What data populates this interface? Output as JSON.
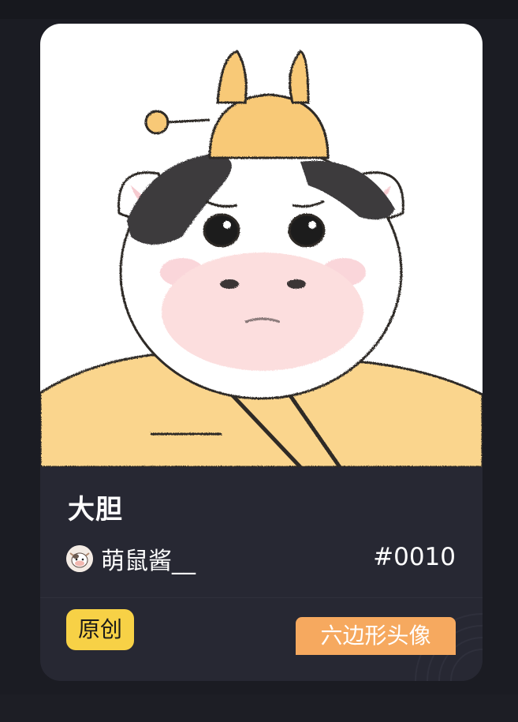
{
  "card": {
    "title": "大胆",
    "creator": {
      "name": "萌鼠酱__",
      "avatar_icon": "cow-avatar-icon"
    },
    "serial": "#0010",
    "badges": {
      "original": "原创",
      "type": "六边形头像"
    }
  },
  "colors": {
    "page_bg": "#1b1c23",
    "card_bg": "#272833",
    "badge_original": "#f7d146",
    "badge_type": "#f6a95f",
    "hat": "#f8c977",
    "robe": "#fad58d"
  }
}
